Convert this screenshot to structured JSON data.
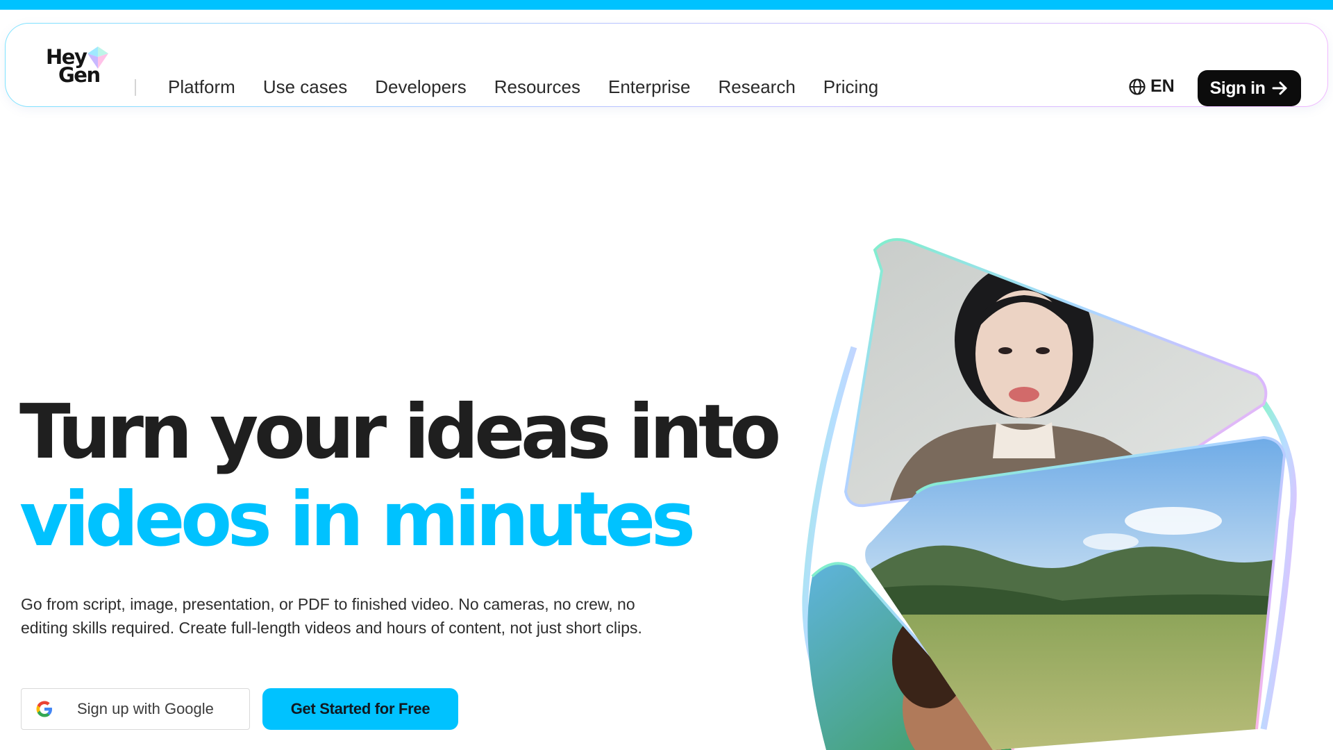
{
  "brand": {
    "name_line1": "Hey",
    "name_line2": "Gen",
    "accent": "#00c2ff",
    "dark": "#0c0c0c"
  },
  "nav": {
    "links": [
      "Platform",
      "Use cases",
      "Developers",
      "Resources",
      "Enterprise",
      "Research",
      "Pricing"
    ],
    "language": "EN",
    "language_icon": "globe-icon",
    "signin_label": "Sign in",
    "signin_icon": "arrow-right-icon"
  },
  "hero": {
    "title_line1": "Turn your ideas into",
    "title_line2": "videos in minutes",
    "description": "Go from script, image, presentation, or PDF to finished video. No cameras, no crew, no editing skills required. Create full-length videos and hours of content, not just short clips.",
    "google_button": "Sign up with Google",
    "google_icon": "google-icon",
    "cta_button": "Get Started for Free"
  }
}
